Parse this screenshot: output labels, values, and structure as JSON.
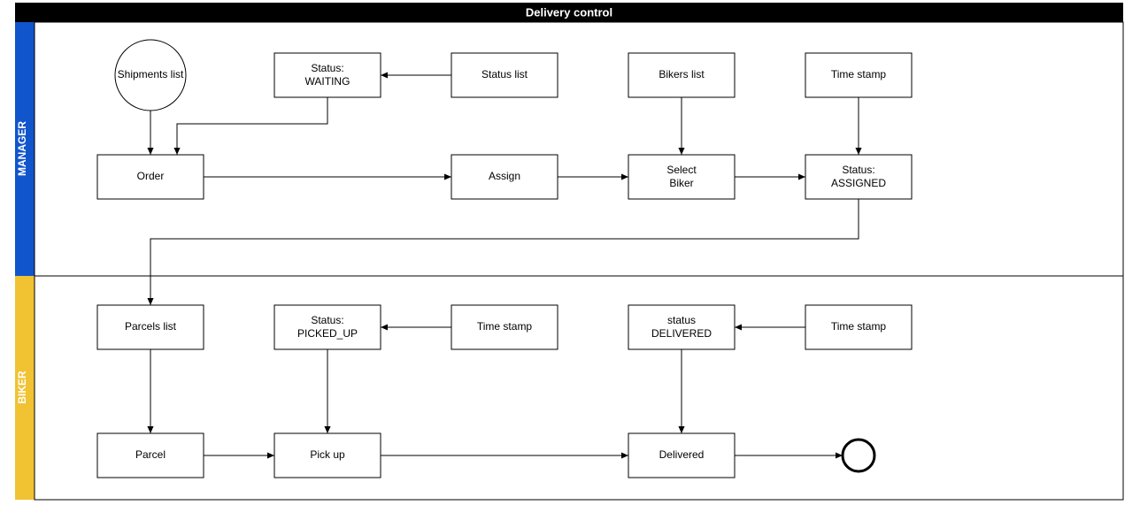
{
  "header": {
    "title": "Delivery control"
  },
  "lanes": {
    "manager": "MANAGER",
    "biker": "BIKER"
  },
  "nodes": {
    "shipments_list": "Shipments list",
    "status_waiting_l1": "Status:",
    "status_waiting_l2": "WAITING",
    "status_list": "Status list",
    "bikers_list": "Bikers list",
    "time_stamp_1": "Time stamp",
    "order": "Order",
    "assign": "Assign",
    "select_biker_l1": "Select",
    "select_biker_l2": "Biker",
    "status_assigned_l1": "Status:",
    "status_assigned_l2": "ASSIGNED",
    "parcels_list": "Parcels list",
    "status_picked_l1": "Status:",
    "status_picked_l2": "PICKED_UP",
    "time_stamp_2": "Time stamp",
    "status_delivered_l1": "status",
    "status_delivered_l2": "DELIVERED",
    "time_stamp_3": "Time stamp",
    "parcel": "Parcel",
    "pick_up": "Pick up",
    "delivered": "Delivered"
  }
}
